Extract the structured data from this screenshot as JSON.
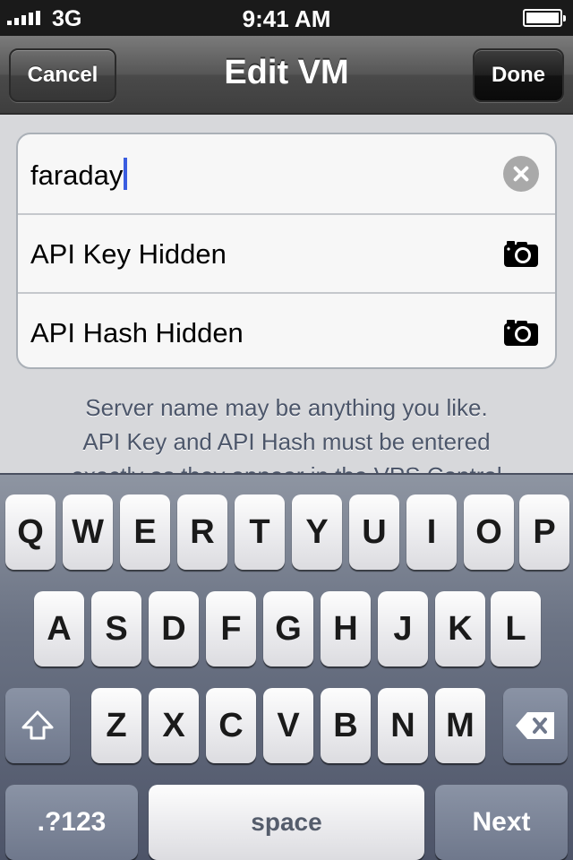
{
  "status_bar": {
    "carrier": "3G",
    "time": "9:41 AM"
  },
  "nav": {
    "title": "Edit VM",
    "cancel_label": "Cancel",
    "done_label": "Done"
  },
  "form": {
    "server_name_value": "faraday",
    "api_key_placeholder": "API Key Hidden",
    "api_hash_placeholder": "API Hash Hidden"
  },
  "help_text": {
    "line1": "Server name may be anything you like.",
    "line2": "API Key and API Hash must be entered",
    "line3": "exactly as they appear in the VPS Control"
  },
  "keyboard": {
    "row1": [
      "Q",
      "W",
      "E",
      "R",
      "T",
      "Y",
      "U",
      "I",
      "O",
      "P"
    ],
    "row2": [
      "A",
      "S",
      "D",
      "F",
      "G",
      "H",
      "J",
      "K",
      "L"
    ],
    "row3": [
      "Z",
      "X",
      "C",
      "V",
      "B",
      "N",
      "M"
    ],
    "numbers_label": ".?123",
    "space_label": "space",
    "next_label": "Next"
  },
  "icons": {
    "clear": "clear-icon",
    "camera": "camera-icon",
    "shift": "shift-icon",
    "delete": "delete-icon"
  }
}
